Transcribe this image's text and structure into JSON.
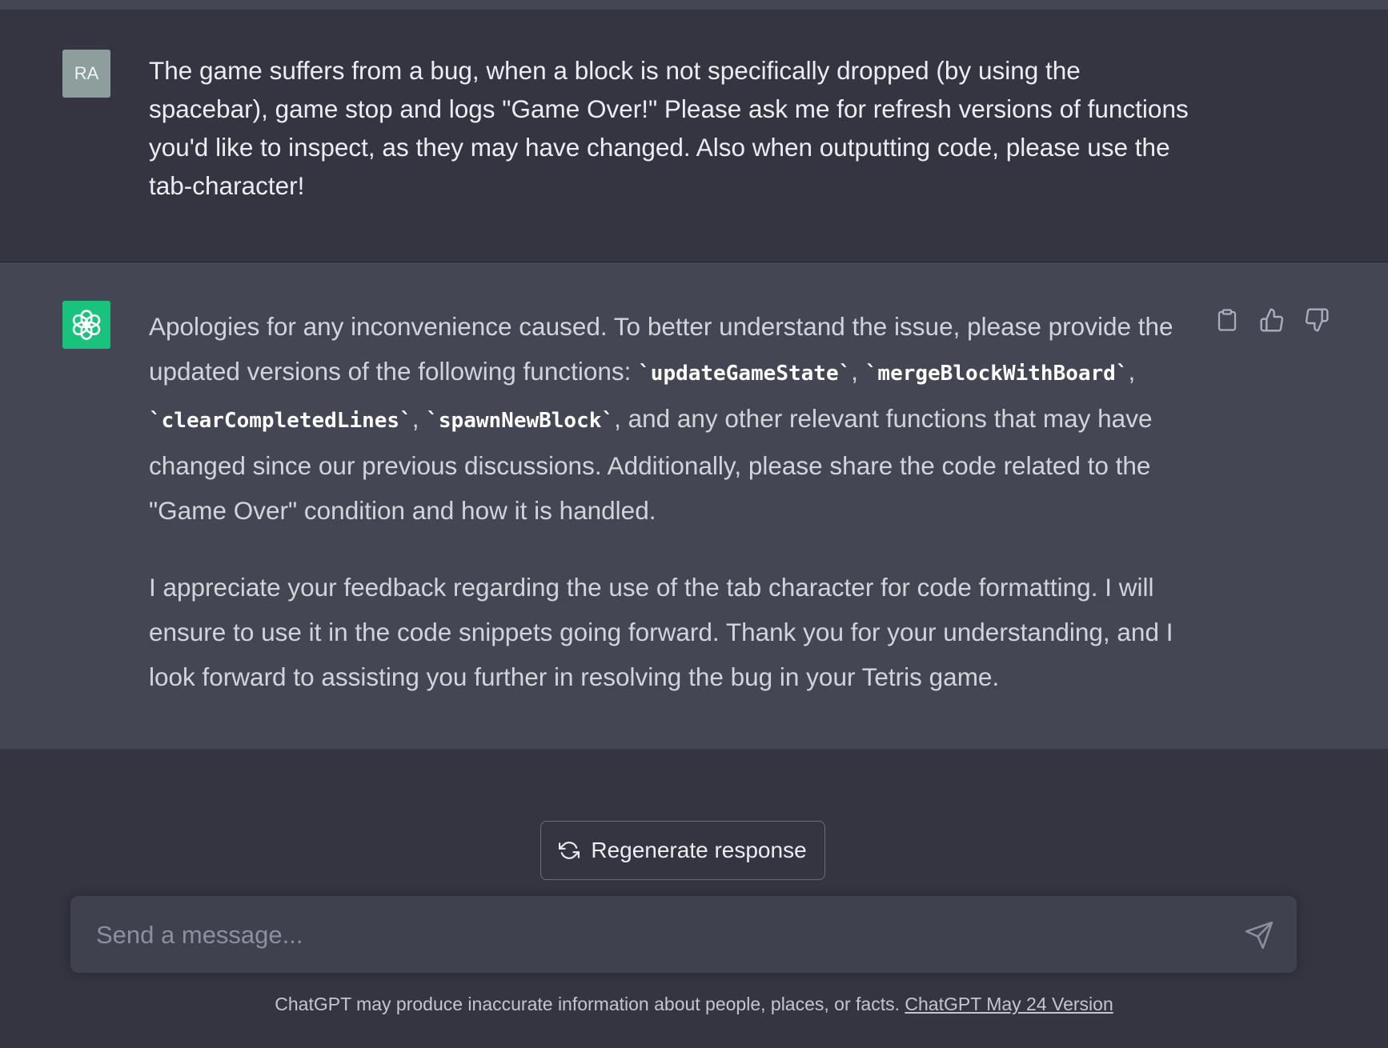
{
  "user_message": {
    "avatar_initials": "RA",
    "text": "The game suffers from a bug, when a block is not specifically dropped (by using the spacebar), game stop and logs \"Game Over!\" Please ask me for refresh versions of functions you'd like to inspect, as they may have changed. Also when outputting code, please use the tab-character!"
  },
  "assistant_message": {
    "avatar_icon": "openai-logo-icon",
    "p1_part1": "Apologies for any inconvenience caused. To better understand the issue, please provide the updated versions of the following functions: ",
    "code1": "`updateGameState`",
    "sep1": ", ",
    "code2": "`mergeBlockWithBoard`",
    "sep2": ", ",
    "code3": "`clearCompletedLines`",
    "sep3": ", ",
    "code4": "`spawnNewBlock`",
    "p1_part2": ", and any other relevant functions that may have changed since our previous discussions. Additionally, please share the code related to the \"Game Over\" condition and how it is handled.",
    "p2": "I appreciate your feedback regarding the use of the tab character for code formatting. I will ensure to use it in the code snippets going forward. Thank you for your understanding, and I look forward to assisting you further in resolving the bug in your Tetris game.",
    "actions": [
      "clipboard-icon",
      "thumbs-up-icon",
      "thumbs-down-icon"
    ]
  },
  "regenerate": {
    "label": "Regenerate response",
    "icon": "refresh-icon"
  },
  "composer": {
    "placeholder": "Send a message...",
    "send_icon": "send-icon"
  },
  "footer": {
    "disclaimer": "ChatGPT may produce inaccurate information about people, places, or facts. ",
    "version_link": "ChatGPT May 24 Version"
  },
  "colors": {
    "background": "#343541",
    "assistant_background": "#444654",
    "gpt_avatar": "#19c37d",
    "user_avatar": "#8e9e9c"
  }
}
